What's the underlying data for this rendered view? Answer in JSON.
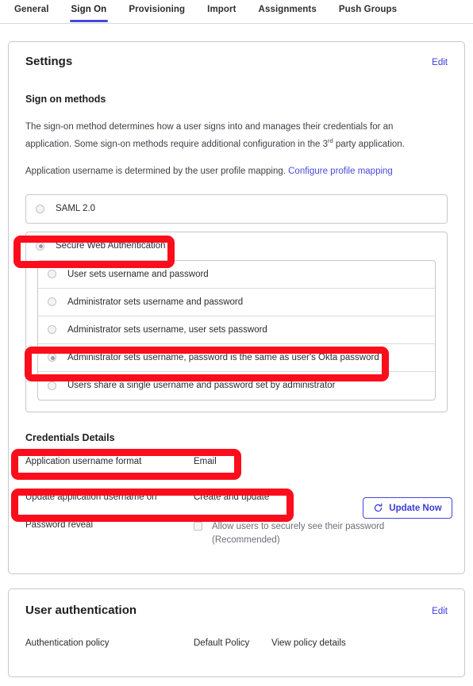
{
  "tabs": [
    {
      "label": "General",
      "active": false
    },
    {
      "label": "Sign On",
      "active": true
    },
    {
      "label": "Provisioning",
      "active": false
    },
    {
      "label": "Import",
      "active": false
    },
    {
      "label": "Assignments",
      "active": false
    },
    {
      "label": "Push Groups",
      "active": false
    }
  ],
  "settings_card": {
    "title": "Settings",
    "edit_label": "Edit",
    "section_title": "Sign on methods",
    "description_line1": "The sign-on method determines how a user signs into and manages their credentials for an application.",
    "description_line2_pre": "Some sign-on methods require additional configuration in the 3",
    "description_line2_sup": "rd",
    "description_line2_post": " party application.",
    "description2_text": "Application username is determined by the user profile mapping. ",
    "description2_link": "Configure profile mapping",
    "methods": [
      {
        "label": "SAML 2.0",
        "checked": false
      },
      {
        "label": "Secure Web Authentication",
        "checked": true
      }
    ],
    "sub_methods": [
      {
        "label": "User sets username and password",
        "checked": false
      },
      {
        "label": "Administrator sets username and password",
        "checked": false
      },
      {
        "label": "Administrator sets username, user sets password",
        "checked": false
      },
      {
        "label": "Administrator sets username, password is the same as user's Okta password",
        "checked": true
      },
      {
        "label": "Users share a single username and password set by administrator",
        "checked": false
      }
    ],
    "credentials": {
      "title": "Credentials Details",
      "username_format_key": "Application username format",
      "username_format_value": "Email",
      "update_username_key": "Update application username on",
      "update_username_value": "Create and update",
      "update_button_label": "Update Now",
      "update_button_icon": "refresh-icon",
      "password_reveal_key": "Password reveal",
      "password_reveal_value_line1": "Allow users to securely see their password",
      "password_reveal_value_line2": "(Recommended)",
      "password_reveal_checked": false
    }
  },
  "userauth_card": {
    "title": "User authentication",
    "edit_label": "Edit",
    "policy_key": "Authentication policy",
    "policy_value": "Default Policy",
    "policy_link": "View policy details"
  },
  "colors": {
    "accent": "#4646e0",
    "link": "#3b3bd6",
    "annotation": "#fc0d1b",
    "border": "#c7c7cf"
  }
}
